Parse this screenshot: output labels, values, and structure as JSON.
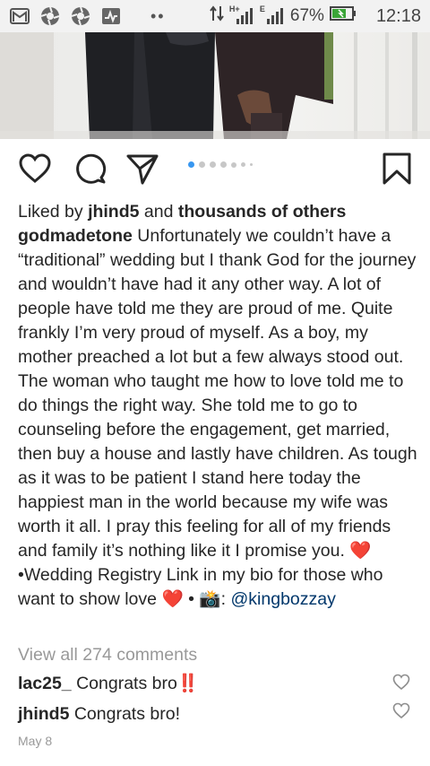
{
  "status_bar": {
    "icons": [
      "gmail-icon",
      "aperture-icon",
      "aperture-icon",
      "activity-icon"
    ],
    "network_label": "H+",
    "network_label_2": "E",
    "battery_percent": "67%",
    "time": "12:18"
  },
  "post": {
    "carousel": {
      "count": 7,
      "current_index": 0
    },
    "liked_prefix": "Liked by",
    "liked_user": "jhind5",
    "liked_and": "and",
    "liked_rest": "thousands of others",
    "username": "godmadetone",
    "caption_text": "Unfortunately we couldn’t have a “traditional” wedding but I thank God for the journey and wouldn’t have had it any other way. A lot of people have told me they are proud of me. Quite frankly I’m very proud of myself. As a boy, my mother preached a lot but a few always stood out. The woman who taught me how to love told me to do things the right way. She told me to go to counseling before the engagement, get married, then buy a house and lastly have children. As tough as it was to be patient I stand here today the happiest man in the world because my wife was worth it all. I pray this feeling for all of my friends and family it’s nothing like it I promise you.",
    "heart_emoji": "❤️",
    "caption_text_2": "•Wedding Registry Link in my bio for those who want to show love",
    "bullet": "•",
    "camera_emoji": "📸",
    "colon": ":",
    "mention": "@kingbozzay",
    "view_all": "View all 274 comments",
    "comments": [
      {
        "user": "lac25_",
        "text": "Congrats bro",
        "emoji": "‼️"
      },
      {
        "user": "jhind5",
        "text": "Congrats bro!",
        "emoji": ""
      }
    ],
    "date": "May 8"
  }
}
